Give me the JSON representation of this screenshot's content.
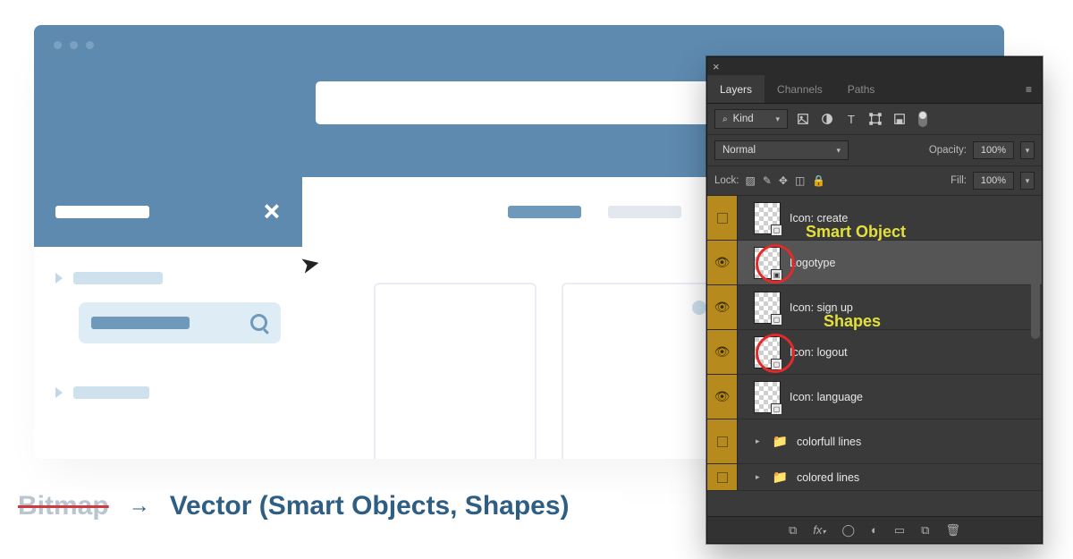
{
  "caption": {
    "bitmap": "Bitmap",
    "arrow": "→",
    "vector": "Vector (Smart Objects, Shapes)"
  },
  "panel": {
    "tabs": [
      "Layers",
      "Channels",
      "Paths"
    ],
    "filter": {
      "kind_label": "Kind"
    },
    "blend": {
      "mode": "Normal",
      "opacity_label": "Opacity:",
      "opacity_value": "100%"
    },
    "lock": {
      "label": "Lock:",
      "fill_label": "Fill:",
      "fill_value": "100%"
    },
    "layers": [
      {
        "visible": false,
        "name": "Icon: create",
        "type": "shape"
      },
      {
        "visible": true,
        "name": "Logotype",
        "type": "smart",
        "selected": true
      },
      {
        "visible": true,
        "name": "Icon: sign up",
        "type": "shape"
      },
      {
        "visible": true,
        "name": "Icon: logout",
        "type": "shape"
      },
      {
        "visible": true,
        "name": "Icon: language",
        "type": "shape"
      },
      {
        "visible": false,
        "name": "colorfull lines",
        "type": "folder"
      },
      {
        "visible": false,
        "name": "colored lines",
        "type": "folder"
      }
    ],
    "annotations": {
      "smart_object": "Smart Object",
      "shapes": "Shapes"
    }
  }
}
